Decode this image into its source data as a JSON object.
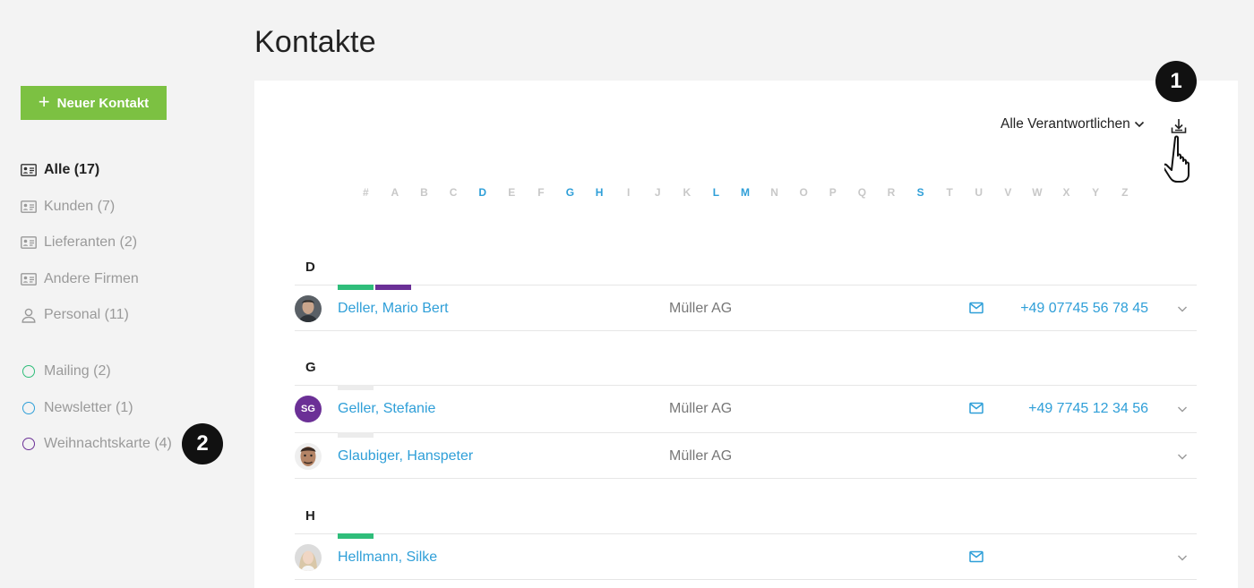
{
  "page": {
    "title": "Kontakte"
  },
  "sidebar": {
    "new_button_label": "Neuer Kontakt",
    "items": [
      {
        "label": "Alle (17)",
        "icon": "contact-card-icon",
        "active": true
      },
      {
        "label": "Kunden (7)",
        "icon": "contact-card-icon"
      },
      {
        "label": "Lieferanten (2)",
        "icon": "contact-card-icon"
      },
      {
        "label": "Andere Firmen",
        "icon": "contact-card-icon"
      },
      {
        "label": "Personal (11)",
        "icon": "person-icon"
      }
    ],
    "lists": [
      {
        "label": "Mailing (2)",
        "color": "#2fbd7a"
      },
      {
        "label": "Newsletter (1)",
        "color": "#2f9fd8"
      },
      {
        "label": "Weihnachtskarte (4)",
        "color": "#6b3096"
      }
    ]
  },
  "badges": {
    "one": "1",
    "two": "2"
  },
  "toolbar": {
    "filter_label": "Alle Verantwortlichen",
    "download_icon": "download-icon",
    "cursor_icon": "hand-pointer-icon"
  },
  "alphabet": {
    "letters": [
      "#",
      "A",
      "B",
      "C",
      "D",
      "E",
      "F",
      "G",
      "H",
      "I",
      "J",
      "K",
      "L",
      "M",
      "N",
      "O",
      "P",
      "Q",
      "R",
      "S",
      "T",
      "U",
      "V",
      "W",
      "X",
      "Y",
      "Z"
    ],
    "active": [
      "D",
      "G",
      "H",
      "L",
      "M",
      "S"
    ],
    "active_color": "#2f9fd8"
  },
  "groups": [
    {
      "letter": "D",
      "contacts": [
        {
          "name": "Deller, Mario Bert",
          "company": "Müller AG",
          "phone": "+49 07745 56 78 45",
          "email": true,
          "tags": [
            "#2fbd7a",
            "#6b3096"
          ],
          "avatar": "photo-dark"
        }
      ]
    },
    {
      "letter": "G",
      "contacts": [
        {
          "name": "Geller, Stefanie",
          "company": "Müller AG",
          "phone": "+49 7745 12 34 56",
          "email": true,
          "tags": [
            "#ececec"
          ],
          "avatar": "initials",
          "initials": "SG",
          "avatar_color": "#6b3096"
        },
        {
          "name": "Glaubiger, Hanspeter",
          "company": "Müller AG",
          "phone": "",
          "email": false,
          "tags": [
            "#ececec"
          ],
          "avatar": "photo-face"
        }
      ]
    },
    {
      "letter": "H",
      "contacts": [
        {
          "name": "Hellmann, Silke",
          "company": "",
          "phone": "",
          "email": true,
          "tags": [
            "#2fbd7a"
          ],
          "avatar": "photo-light"
        }
      ]
    }
  ],
  "colors": {
    "accent": "#2f9fd8",
    "primary_button": "#7cc142"
  }
}
